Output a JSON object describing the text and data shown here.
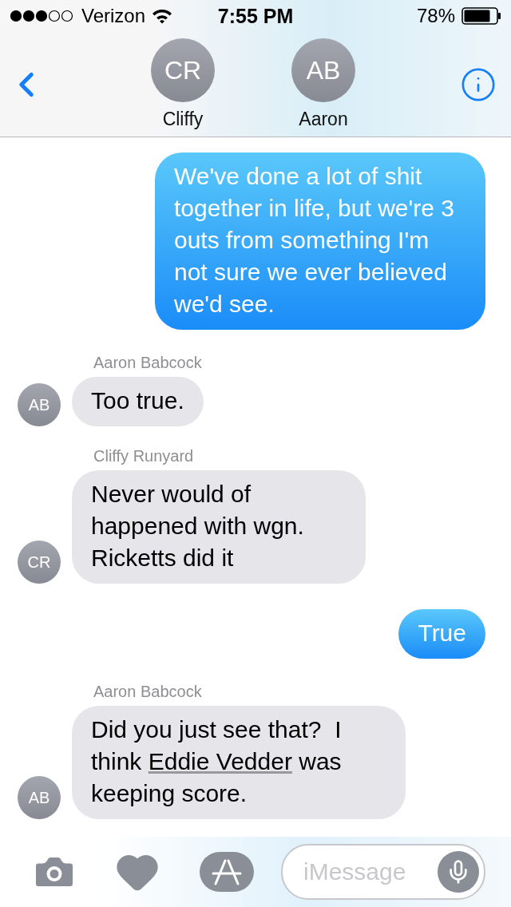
{
  "status_bar": {
    "carrier": "Verizon",
    "time": "7:55 PM",
    "battery": "78%"
  },
  "nav": {
    "contacts": [
      {
        "initials": "CR",
        "name": "Cliffy"
      },
      {
        "initials": "AB",
        "name": "Aaron"
      }
    ]
  },
  "messages": [
    {
      "kind": "outgoing",
      "text": "We've done a lot of shit together in life, but we're 3 outs from something I'm not sure we ever believed we'd see."
    },
    {
      "kind": "incoming",
      "sender": "Aaron Babcock",
      "initials": "AB",
      "text": "Too true."
    },
    {
      "kind": "incoming",
      "sender": "Cliffy Runyard",
      "initials": "CR",
      "text": "Never would of happened with wgn. Ricketts did it"
    },
    {
      "kind": "outgoing",
      "text": "True"
    },
    {
      "kind": "incoming",
      "sender": "Aaron Babcock",
      "initials": "AB",
      "text": "Did you just see that?  I think ",
      "link": "Eddie Vedder",
      "text_after": " was keeping score."
    }
  ],
  "composer": {
    "placeholder": "iMessage"
  }
}
